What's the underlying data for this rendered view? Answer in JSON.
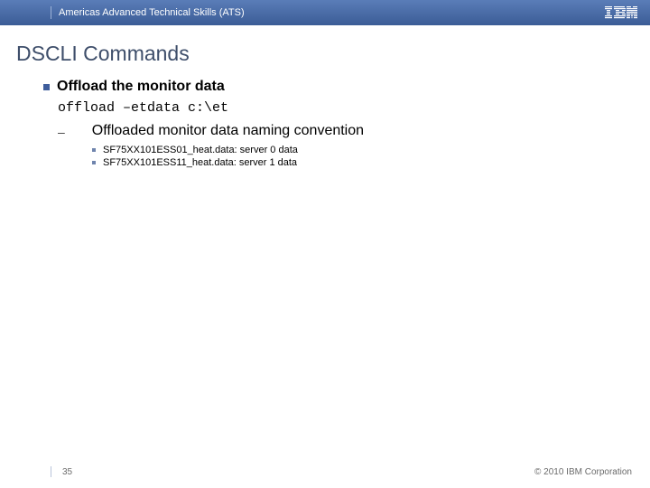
{
  "header": {
    "org_title": "Americas Advanced Technical Skills (ATS)",
    "logo_name": "ibm-logo"
  },
  "slide": {
    "title": "DSCLI Commands",
    "bullet_main": "Offload the monitor data",
    "code_line": "offload –etdata c:\\et",
    "sub_bullet": "Offloaded monitor data naming convention",
    "sub_items": [
      "SF75XX101ESS01_heat.data:  server 0 data",
      "SF75XX101ESS11_heat.data:  server 1 data"
    ]
  },
  "footer": {
    "page": "35",
    "copyright": "© 2010 IBM Corporation"
  }
}
